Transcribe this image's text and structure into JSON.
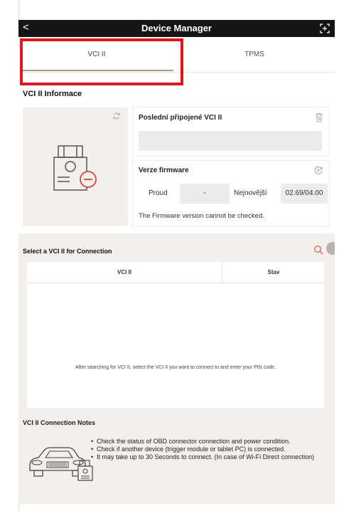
{
  "titlebar": {
    "back": "<",
    "title": "Device Manager"
  },
  "tabs": [
    {
      "label": "VCI II",
      "active": true
    },
    {
      "label": "TPMS",
      "active": false
    }
  ],
  "section_title": "VCI II Informace",
  "last_connected": {
    "label": "Poslední připojené VCI II",
    "value": ""
  },
  "firmware": {
    "label": "Verze firmware",
    "current_label": "Proud",
    "current_value": "-",
    "latest_label": "Nejnovější",
    "latest_value": "02.69/04.00",
    "message": "The Firmware version cannot be checked."
  },
  "connection": {
    "title": "Select a VCI II for Connection",
    "columns": [
      "VCI II",
      "Stav"
    ],
    "empty_message": "After searching for VCI II, select the VCI II you want to connect to and enter your PIN code."
  },
  "notes": {
    "title": "VCI II Connection Notes",
    "items": [
      "Check the status of OBD connector connection and power condition.",
      "Check if another device (trigger module or tablet PC) is connected.",
      "It may take up to 30 Seconds to connect. (In case of Wi-Fi Direct connection)"
    ]
  },
  "colors": {
    "highlight": "#e8141a",
    "tab_underline": "#b39a8c",
    "panel_bg": "#f3efed",
    "search_accent": "#d8795b"
  },
  "icons": [
    "back-icon",
    "expand-icon",
    "refresh-icon",
    "vci-device-icon",
    "trash-icon",
    "firmware-check-icon",
    "search-icon",
    "car-icon"
  ]
}
